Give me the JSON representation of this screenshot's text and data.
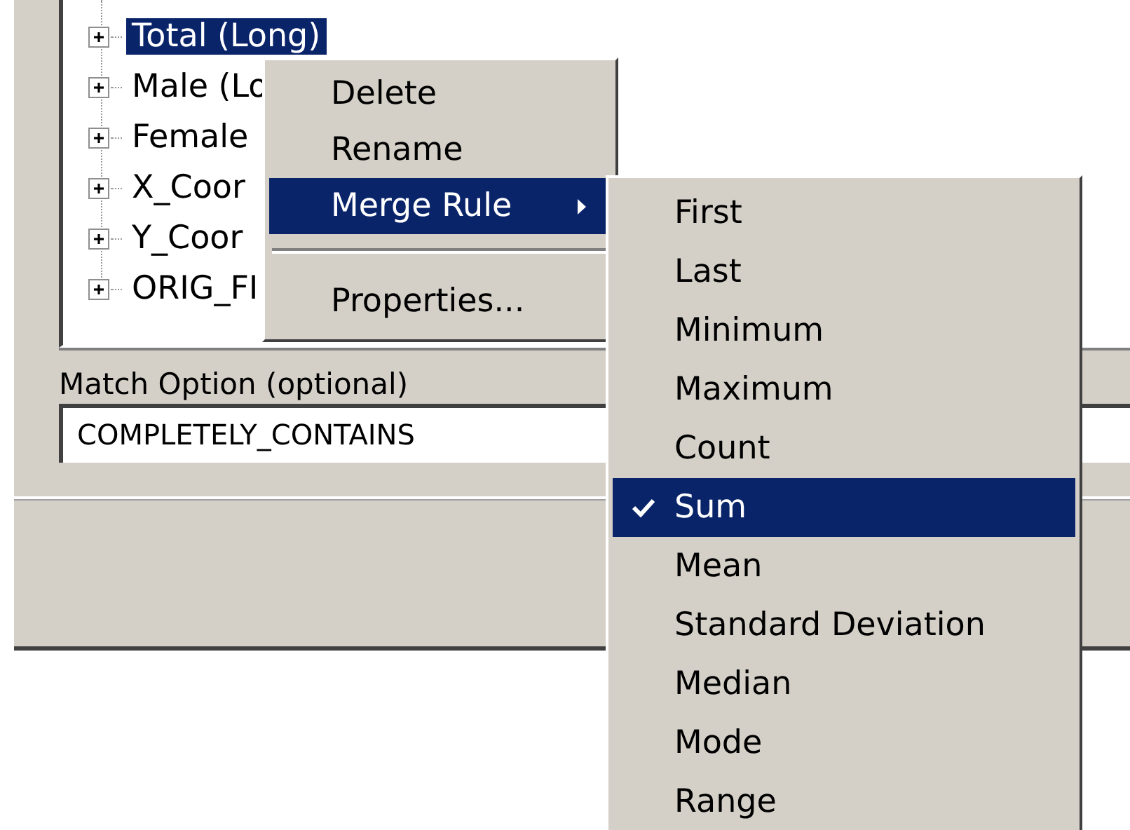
{
  "tree": {
    "items": [
      {
        "label": "Total (Long)",
        "selected": true,
        "expanded": false
      },
      {
        "label": "Male (Lo",
        "selected": false,
        "expanded": false
      },
      {
        "label": "Female",
        "selected": false,
        "expanded": false
      },
      {
        "label": "X_Coor",
        "selected": false,
        "expanded": false
      },
      {
        "label": "Y_Coor",
        "selected": false,
        "expanded": false
      },
      {
        "label": "ORIG_FI",
        "selected": false,
        "expanded": false
      }
    ]
  },
  "match_option": {
    "label": "Match Option (optional)",
    "value": "COMPLETELY_CONTAINS"
  },
  "context_menu": {
    "items": [
      {
        "kind": "item",
        "label": "Delete",
        "selected": false
      },
      {
        "kind": "item",
        "label": "Rename",
        "selected": false
      },
      {
        "kind": "submenu",
        "label": "Merge Rule",
        "selected": true
      },
      {
        "kind": "separator"
      },
      {
        "kind": "item",
        "label": "Properties...",
        "selected": false
      }
    ]
  },
  "submenu": {
    "items": [
      {
        "label": "First",
        "checked": false,
        "selected": false
      },
      {
        "label": "Last",
        "checked": false,
        "selected": false
      },
      {
        "label": "Minimum",
        "checked": false,
        "selected": false
      },
      {
        "label": "Maximum",
        "checked": false,
        "selected": false
      },
      {
        "label": "Count",
        "checked": false,
        "selected": false
      },
      {
        "label": "Sum",
        "checked": true,
        "selected": true
      },
      {
        "label": "Mean",
        "checked": false,
        "selected": false
      },
      {
        "label": "Standard Deviation",
        "checked": false,
        "selected": false
      },
      {
        "label": "Median",
        "checked": false,
        "selected": false
      },
      {
        "label": "Mode",
        "checked": false,
        "selected": false
      },
      {
        "label": "Range",
        "checked": false,
        "selected": false
      }
    ]
  }
}
